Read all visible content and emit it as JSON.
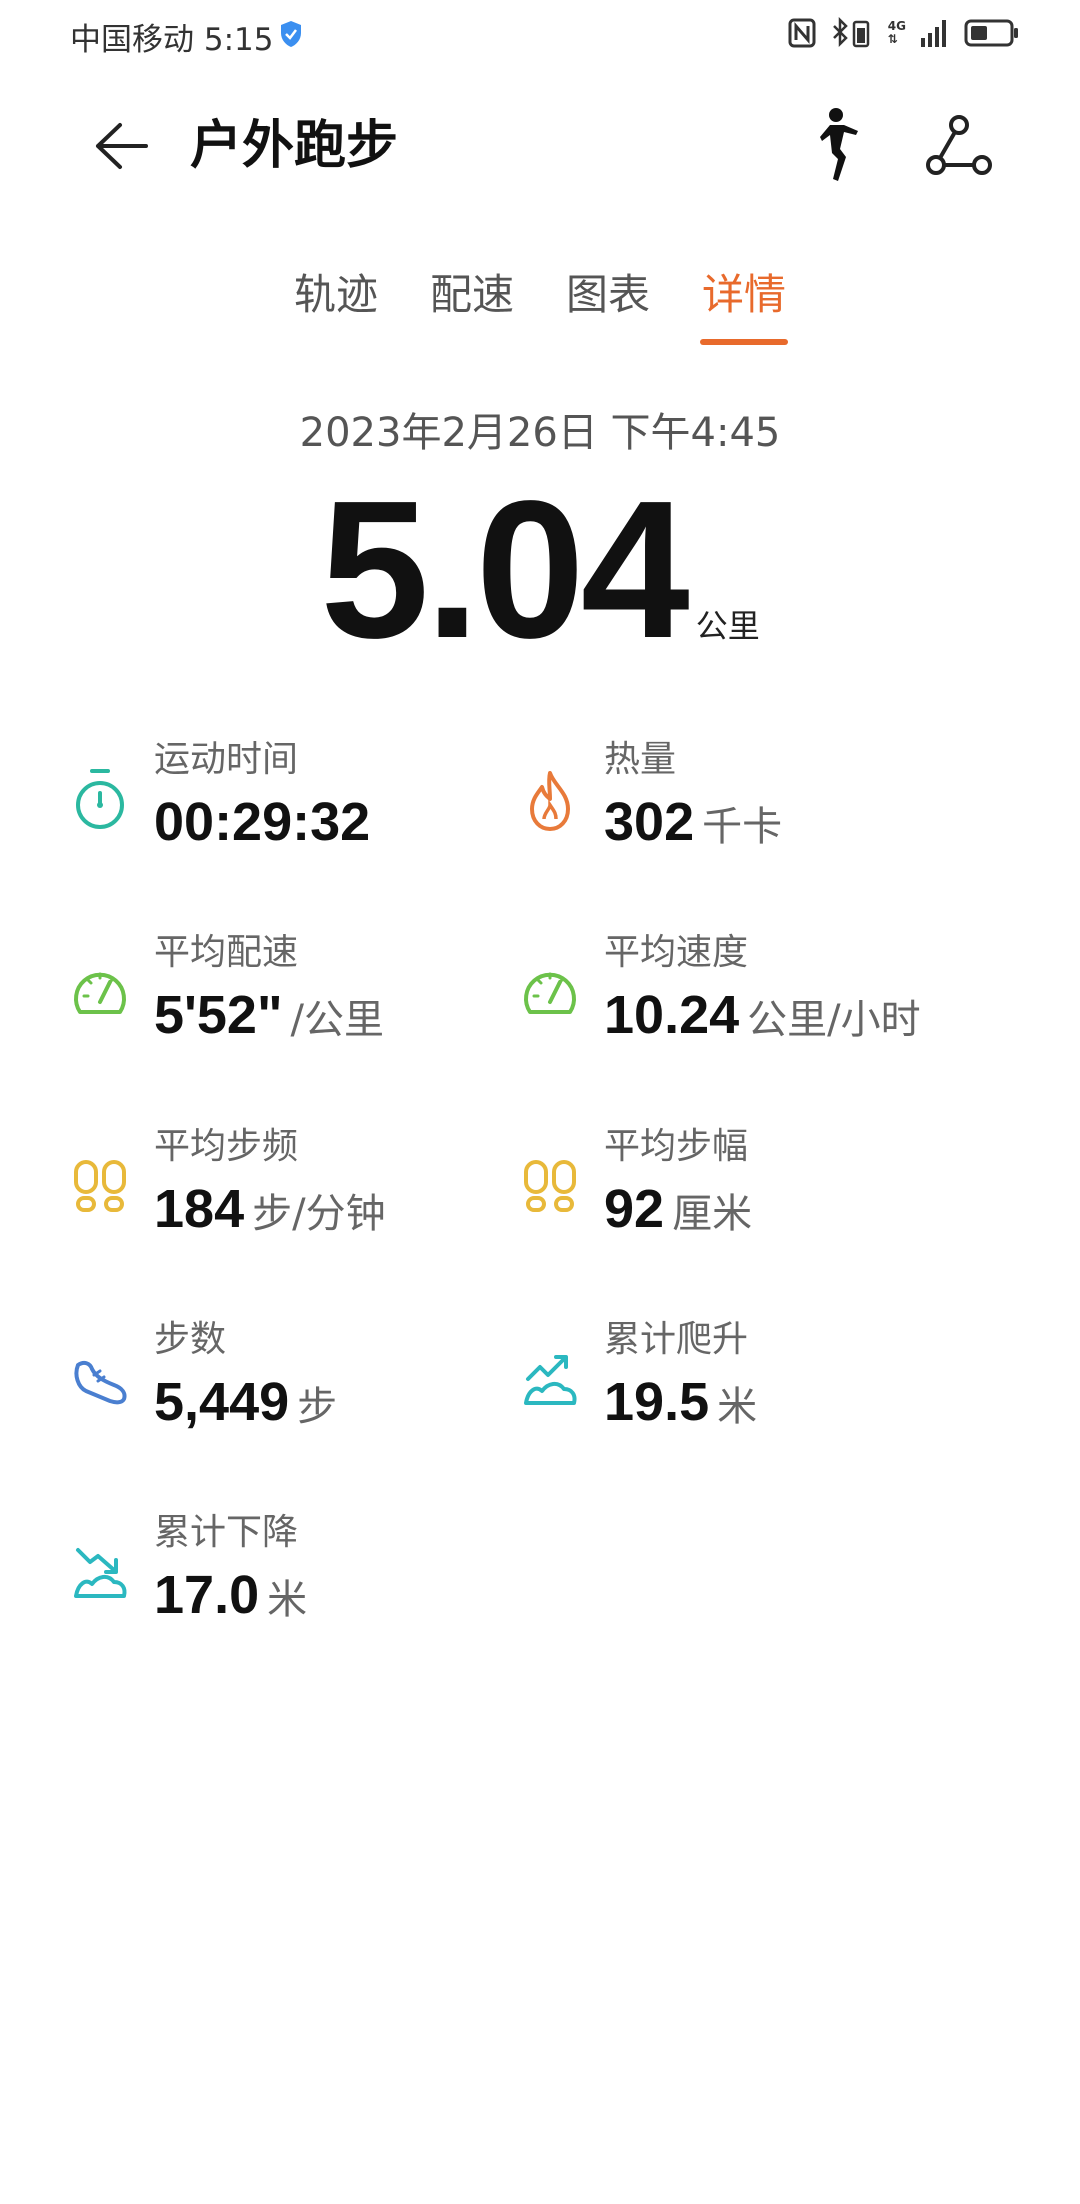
{
  "status_bar": {
    "carrier_time": "中国移动 5:15",
    "network": "4G"
  },
  "header": {
    "title": "户外跑步"
  },
  "tabs": [
    {
      "label": "轨迹",
      "active": false
    },
    {
      "label": "配速",
      "active": false
    },
    {
      "label": "图表",
      "active": false
    },
    {
      "label": "详情",
      "active": true
    }
  ],
  "summary": {
    "date": "2023年2月26日 下午4:45",
    "distance": "5.04",
    "distance_unit": "公里"
  },
  "metrics": [
    {
      "label": "运动时间",
      "value": "00:29:32",
      "unit": "",
      "icon": "stopwatch-icon",
      "color": "#2bb8a0"
    },
    {
      "label": "热量",
      "value": "302",
      "unit": "千卡",
      "icon": "flame-icon",
      "color": "#e87a3a"
    },
    {
      "label": "平均配速",
      "value": "5'52\"",
      "unit": "/公里",
      "icon": "speedometer-icon",
      "color": "#6cc24a"
    },
    {
      "label": "平均速度",
      "value": "10.24",
      "unit": "公里/小时",
      "icon": "speedometer-icon",
      "color": "#6cc24a"
    },
    {
      "label": "平均步频",
      "value": "184",
      "unit": "步/分钟",
      "icon": "footprints-icon",
      "color": "#e8b93a"
    },
    {
      "label": "平均步幅",
      "value": "92",
      "unit": "厘米",
      "icon": "footprints-icon",
      "color": "#e8b93a"
    },
    {
      "label": "步数",
      "value": "5,449",
      "unit": "步",
      "icon": "shoe-icon",
      "color": "#4a7fd0"
    },
    {
      "label": "累计爬升",
      "value": "19.5",
      "unit": "米",
      "icon": "ascent-icon",
      "color": "#2bb8c0"
    },
    {
      "label": "累计下降",
      "value": "17.0",
      "unit": "米",
      "icon": "descent-icon",
      "color": "#2bb8c0"
    }
  ],
  "colors": {
    "accent": "#e86a2c",
    "text": "#111111",
    "muted": "#666666"
  }
}
